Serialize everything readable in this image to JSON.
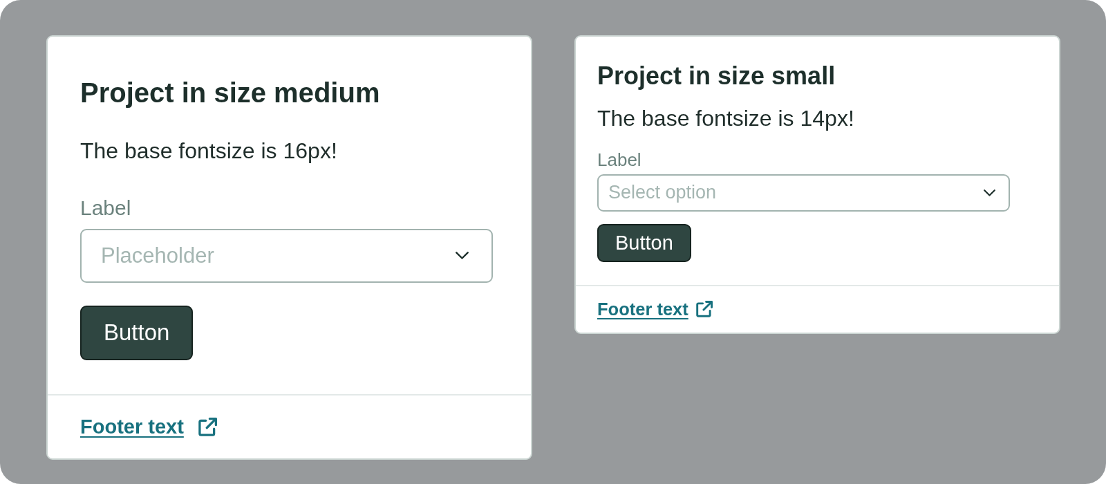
{
  "cards": [
    {
      "kind": "medium",
      "title": "Project in size medium",
      "text": "The base fontsize is 16px!",
      "field": {
        "label": "Label",
        "placeholder": "Placeholder"
      },
      "button": "Button",
      "footer_link": "Footer text"
    },
    {
      "kind": "small",
      "title": "Project in size small",
      "text": "The base fontsize is 14px!",
      "field": {
        "label": "Label",
        "placeholder": "Select option"
      },
      "button": "Button",
      "footer_link": "Footer text"
    }
  ]
}
